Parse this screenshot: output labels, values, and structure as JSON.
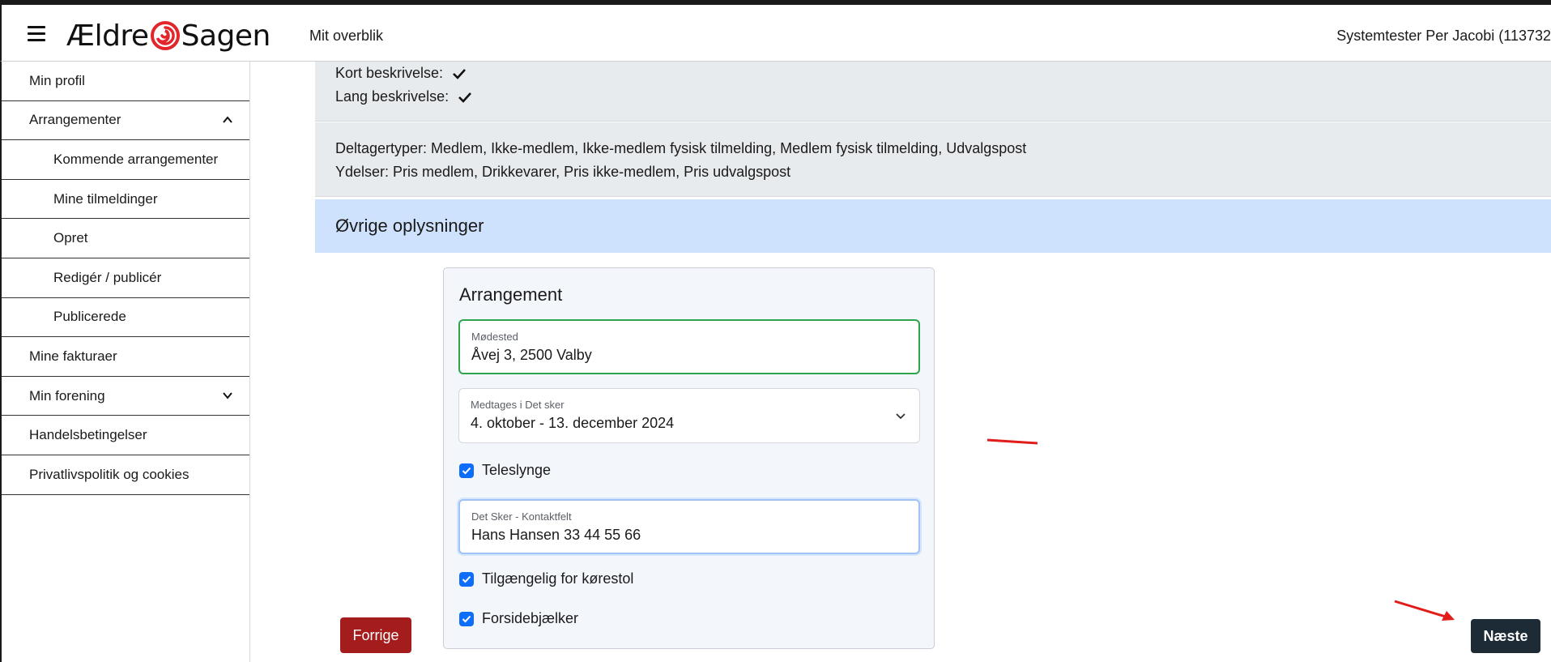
{
  "header": {
    "logo_left": "Ældre",
    "logo_right": "Sagen",
    "nav_title": "Mit overblik",
    "user": "Systemtester Per Jacobi (113732"
  },
  "sidebar": {
    "items": [
      {
        "label": "Min profil",
        "sub": false
      },
      {
        "label": "Arrangementer",
        "sub": false,
        "chevron": "up"
      },
      {
        "label": "Kommende arrangementer",
        "sub": true
      },
      {
        "label": "Mine tilmeldinger",
        "sub": true
      },
      {
        "label": "Opret",
        "sub": true
      },
      {
        "label": "Redigér / publicér",
        "sub": true
      },
      {
        "label": "Publicerede",
        "sub": true
      },
      {
        "label": "Mine fakturaer",
        "sub": false
      },
      {
        "label": "Min forening",
        "sub": false,
        "chevron": "down"
      },
      {
        "label": "Handelsbetingelser",
        "sub": false
      },
      {
        "label": "Privatlivspolitik og cookies",
        "sub": false
      }
    ]
  },
  "summary": {
    "kort": "Kort beskrivelse:",
    "lang": "Lang beskrivelse:",
    "deltagertyper": "Deltagertyper: Medlem, Ikke-medlem, Ikke-medlem fysisk tilmelding, Medlem fysisk tilmelding, Udvalgspost",
    "ydelser": "Ydelser: Pris medlem, Drikkevarer, Pris ikke-medlem, Pris udvalgspost"
  },
  "section": {
    "title": "Øvrige oplysninger"
  },
  "card": {
    "title": "Arrangement",
    "modested": {
      "label": "Mødested",
      "value": "Åvej 3, 2500 Valby"
    },
    "medtages": {
      "label": "Medtages i Det sker",
      "value": "4. oktober - 13. december 2024"
    },
    "teleslynge": {
      "label": "Teleslynge",
      "checked": true
    },
    "kontakt": {
      "label": "Det Sker - Kontaktfelt",
      "value": "Hans Hansen 33 44 55 66"
    },
    "korestol": {
      "label": "Tilgængelig for kørestol",
      "checked": true
    },
    "forside": {
      "label": "Forsidebjælker",
      "checked": true
    }
  },
  "buttons": {
    "prev": "Forrige",
    "next": "Næste"
  },
  "colors": {
    "brand_red": "#e3262b",
    "prev_button": "#a51c1c",
    "next_button": "#1c2b36",
    "section_bg": "#cfe2fd",
    "checkbox": "#0d6efd",
    "annotation": "#e21b1b"
  }
}
